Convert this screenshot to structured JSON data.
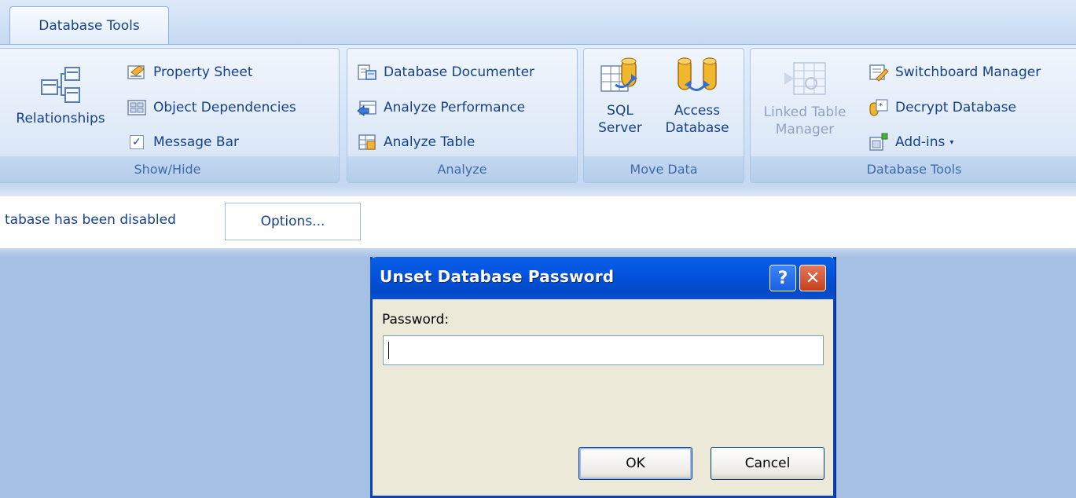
{
  "tabs": [
    {
      "label": "Database Tools",
      "selected": true
    }
  ],
  "ribbon": {
    "show_hide": {
      "label": "Show/Hide",
      "relationships": "Relationships",
      "property_sheet": "Property Sheet",
      "object_dependencies": "Object Dependencies",
      "message_bar": {
        "label": "Message Bar",
        "checked": true,
        "check_glyph": "✓"
      }
    },
    "analyze": {
      "label": "Analyze",
      "database_documenter": "Database Documenter",
      "analyze_performance": "Analyze Performance",
      "analyze_table": "Analyze Table"
    },
    "move_data": {
      "label": "Move Data",
      "sql_server": "SQL\nServer",
      "access_database": "Access\nDatabase"
    },
    "database_tools": {
      "label": "Database Tools",
      "linked_table_manager": "Linked Table\nManager",
      "switchboard_manager": "Switchboard Manager",
      "decrypt_database": "Decrypt Database",
      "add_ins": "Add-ins",
      "add_ins_caret": "▾"
    }
  },
  "message_bar": {
    "text": "tabase has been disabled",
    "options_button": "Options..."
  },
  "dialog": {
    "title": "Unset Database Password",
    "help_glyph": "?",
    "close_glyph": "✕",
    "password_label": "Password:",
    "password_value": "",
    "ok_label": "OK",
    "cancel_label": "Cancel"
  },
  "colors": {
    "ribbon_text": "#15428b",
    "workspace": "#a6c0e3",
    "dialog_titlebar": "#0454e0",
    "dialog_body": "#ece9d8"
  }
}
